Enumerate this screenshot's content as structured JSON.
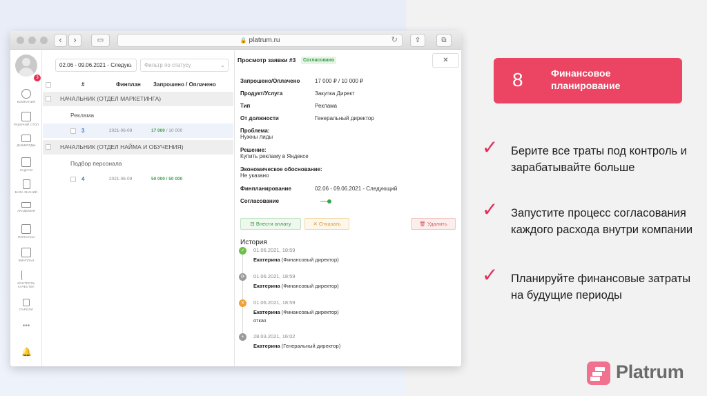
{
  "browser": {
    "url": "platrum.ru"
  },
  "sidebar": {
    "badge": "3",
    "items": [
      {
        "label": "КОМПАНИЯ",
        "icon": "company-icon"
      },
      {
        "label": "РАБОЧИЙ СТОЛ",
        "icon": "desktop-icon"
      },
      {
        "label": "ДАШБОРДЫ",
        "icon": "dashboard-icon"
      },
      {
        "label": "ЗАДАЧИ",
        "icon": "tasks-icon"
      },
      {
        "label": "БАЗА ЗНАНИЙ",
        "icon": "knowledge-base-icon"
      },
      {
        "label": "АКАДЕМИЯ",
        "icon": "academy-icon"
      },
      {
        "label": "ФИНАНСЫ",
        "icon": "finance-icon"
      },
      {
        "label": "ФИНПЛАН",
        "icon": "finplan-icon"
      },
      {
        "label": "КОНТРОЛЬ КАЧЕСТВА",
        "icon": "quality-control-icon"
      },
      {
        "label": "ПАРОЛИ",
        "icon": "passwords-icon"
      }
    ],
    "more": "•••"
  },
  "list": {
    "period_filter": "02.06 - 09.06.2021 - Следую",
    "status_filter_placeholder": "Фильтр по статусу",
    "headers": {
      "num": "#",
      "finplan": "Финплан",
      "requested": "Запрошено / Оплачено"
    },
    "groups": [
      {
        "title": "НАЧАЛЬНИК (ОТДЕЛ МАРКЕТИНГА)",
        "sub": "Реклама",
        "row": {
          "num": "3",
          "date": "2021-06-09",
          "paid": "17 000",
          "total": " / 10 000"
        }
      },
      {
        "title": "НАЧАЛЬНИК (ОТДЕЛ НАЙМА И ОБУЧЕНИЯ)",
        "sub": "Подбор персонала",
        "row": {
          "num": "4",
          "date": "2021-06-09",
          "paid": "50 000 / 50 000",
          "total": ""
        }
      }
    ]
  },
  "detail": {
    "title": "Просмотр заявки #3",
    "status": "Согласовано",
    "close": "✕",
    "fields": {
      "requested_label": "Запрошено/Оплачено",
      "requested_value": "17 000 ₽ / 10 000 ₽",
      "product_label": "Продукт/Услуга",
      "product_value": "Закупка Директ",
      "type_label": "Тип",
      "type_value": "Реклама",
      "from_label": "От должности",
      "from_value": "Генеральный директор",
      "problem_label": "Проблема:",
      "problem_value": "Нужны лиды",
      "solution_label": "Решение:",
      "solution_value": "Купить рекламу в Яндексе",
      "econ_label": "Экономическое обоснование:",
      "econ_value": "Не указано",
      "finplan_label": "Финпланирование",
      "finplan_value": "02.06 - 09.06.2021 - Следующий",
      "approval_label": "Согласование"
    },
    "actions": {
      "pay": "Внести оплату",
      "reject": "Отказать",
      "delete": "Удалить"
    },
    "history_title": "История",
    "history": [
      {
        "date": "01.06.2021, 18:59",
        "name": "Екатерина",
        "role": " (Финансовый директор)",
        "note": "",
        "color": "#6cc04a",
        "glyph": "✓"
      },
      {
        "date": "01.06.2021, 18:59",
        "name": "Екатерина",
        "role": " (Финансовый директор)",
        "note": "",
        "color": "#9a9a9a",
        "glyph": "⟳"
      },
      {
        "date": "01.06.2021, 18:59",
        "name": "Екатерина",
        "role": " (Финансовый директор)",
        "note": "отказ",
        "color": "#f0a030",
        "glyph": "✕"
      },
      {
        "date": "28.03.2021, 16:02",
        "name": "Екатерина",
        "role": " (Генеральный директор)",
        "note": "",
        "color": "#9a9a9a",
        "glyph": "+"
      }
    ]
  },
  "slide": {
    "number": "8",
    "heading": "Финансовое планирование",
    "bullets": [
      "Берите все траты под контроль и зарабатывайте больше",
      "Запустите процесс согласования каждого расхода внутри компании",
      "Планируйте финансовые затраты на будущие периоды"
    ],
    "check_glyph": "✓",
    "accent_color": "#ec4463",
    "logo_text": "Platrum"
  }
}
